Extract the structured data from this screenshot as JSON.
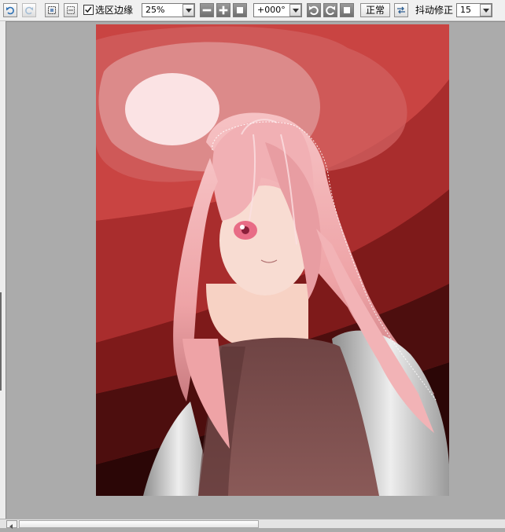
{
  "toolbar": {
    "undo_icon": "undo-icon",
    "redo_icon": "redo-icon",
    "selection_edge": {
      "label": "选区边缘",
      "checked": true
    },
    "zoom": {
      "value": "25%"
    },
    "rotation": {
      "value": "+000°"
    },
    "blend_mode": {
      "label": "正常"
    },
    "stabilizer": {
      "label": "抖动修正",
      "value": "15"
    }
  },
  "colors": {
    "toolbar_bg": "#f0f0f0",
    "canvas_bg": "#ababab",
    "art_sky_top": "#c94442",
    "art_sky_dark": "#2b0606",
    "hair": "#f2b6b6"
  }
}
